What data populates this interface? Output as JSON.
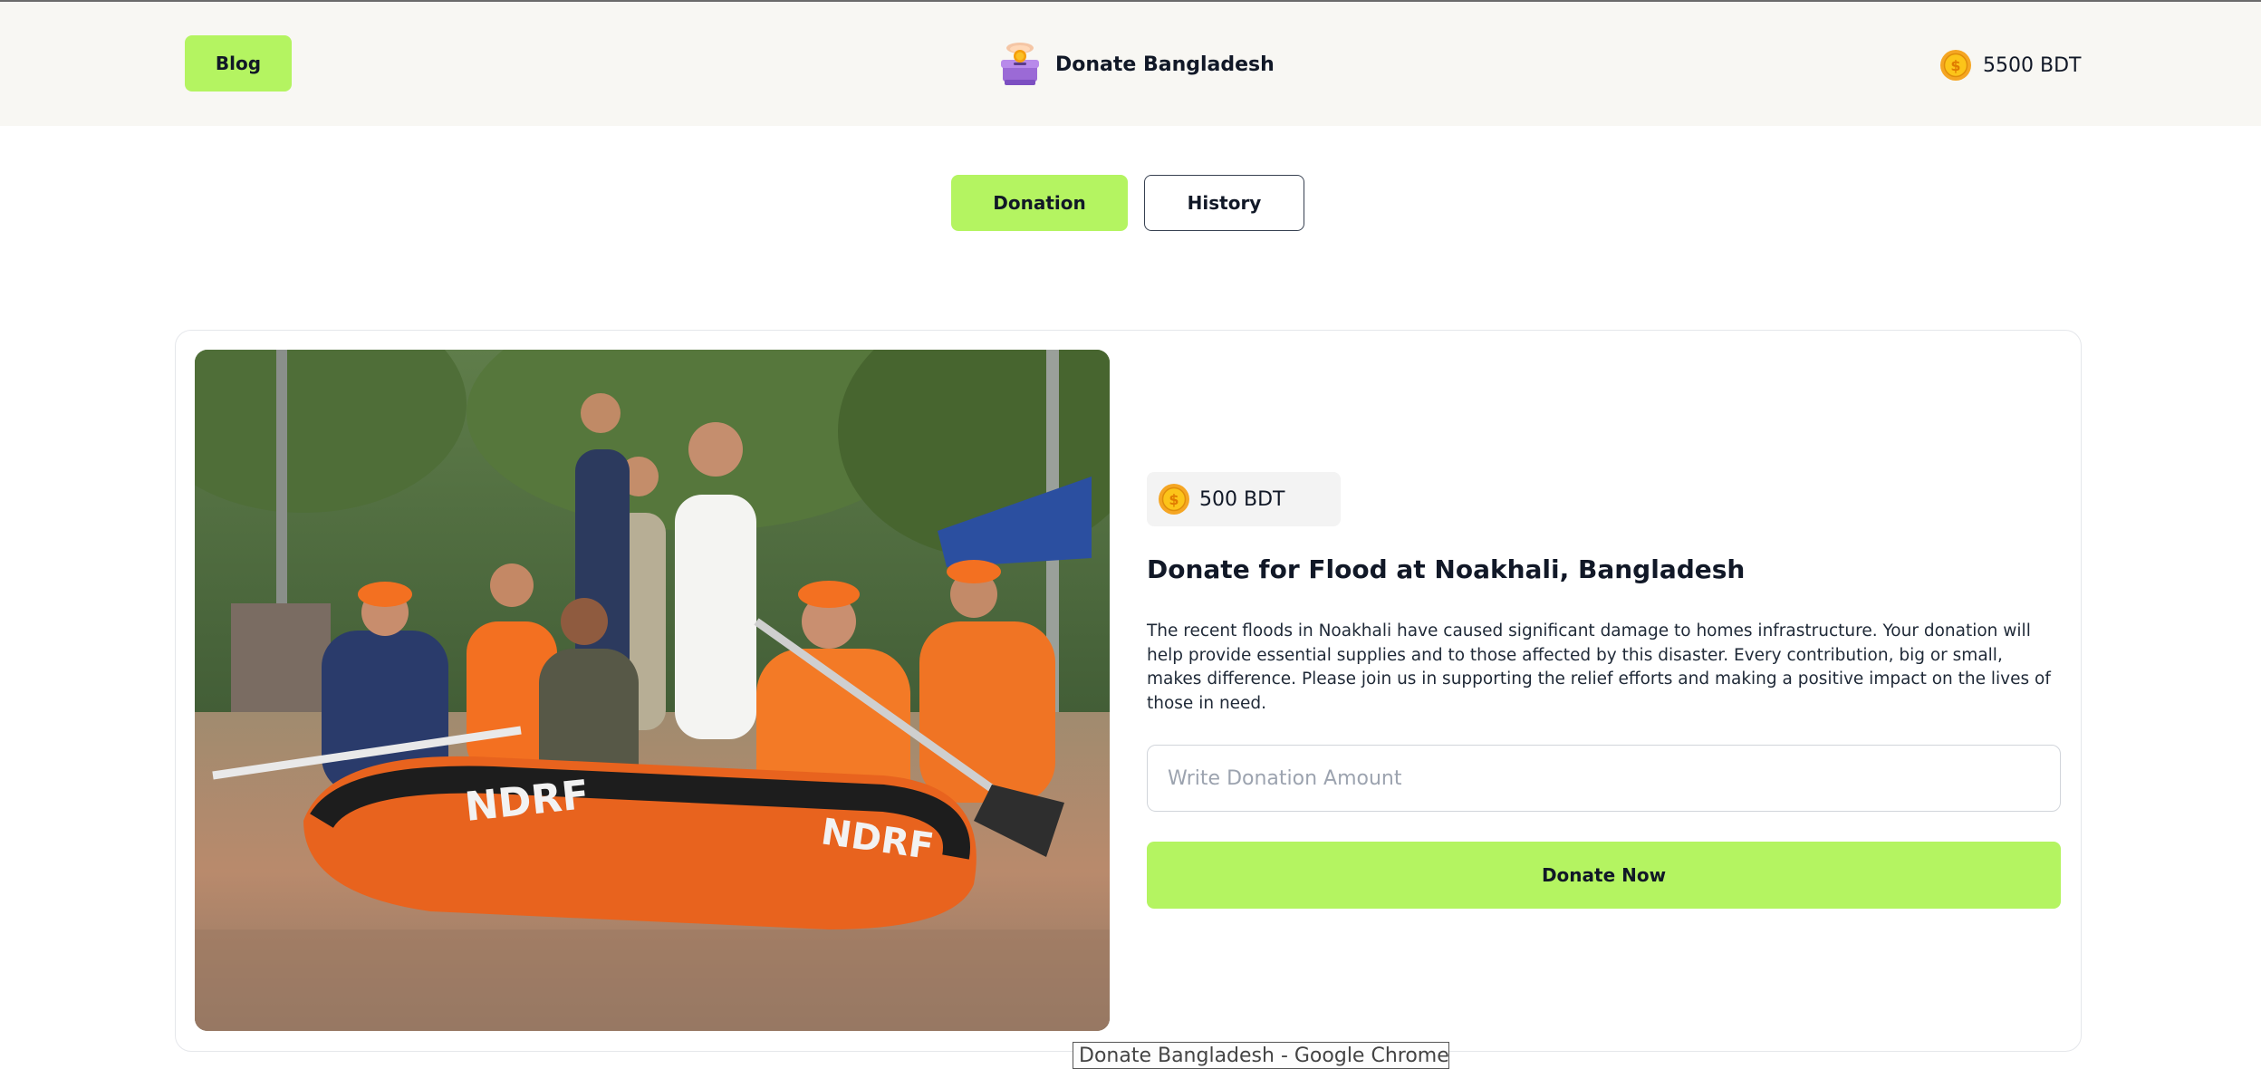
{
  "header": {
    "blog_label": "Blog",
    "brand_name": "Donate Bangladesh",
    "balance": "5500 BDT"
  },
  "tabs": [
    {
      "label": "Donation",
      "active": true
    },
    {
      "label": "History",
      "active": false
    }
  ],
  "card": {
    "image_icon": "flood-rescue-photo",
    "amount": "500 BDT",
    "title": "Donate for Flood at Noakhali, Bangladesh",
    "description": "The recent floods in Noakhali have caused significant damage to homes infrastructure. Your donation will help provide essential supplies and to those affected by this disaster. Every contribution, big or small, makes difference. Please join us in supporting the relief efforts and making a positive impact on the lives of those in need.",
    "input_placeholder": "Write Donation Amount",
    "input_value": "",
    "donate_label": "Donate Now"
  },
  "tooltip": "Donate Bangladesh - Google Chrome",
  "colors": {
    "accent": "#b4f461",
    "header_bg": "#f8f7f3",
    "coin": "#f5a623"
  }
}
